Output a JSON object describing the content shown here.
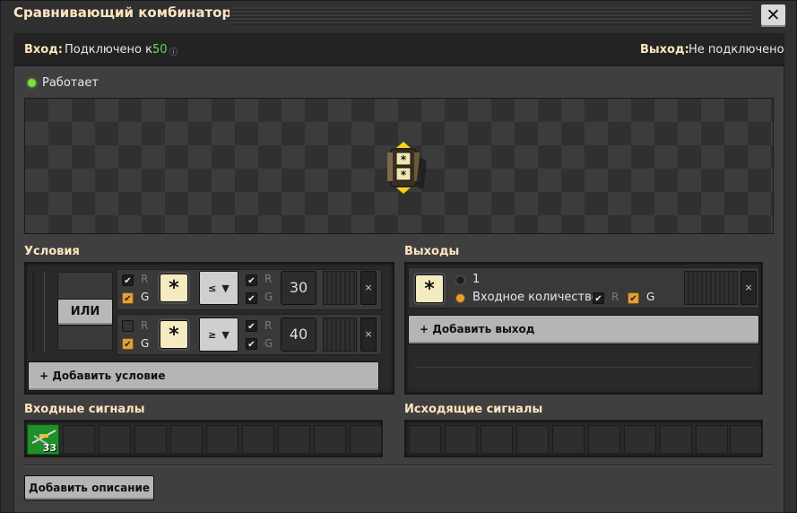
{
  "window": {
    "title": "Сравнивающий комбинатор",
    "close_label": "✕"
  },
  "status": {
    "input_label": "Вход:",
    "input_text": "Подключено к:",
    "input_count": "50",
    "output_label": "Выход:",
    "output_text": "Не подключено"
  },
  "state": {
    "text": "Работает"
  },
  "conditions": {
    "heading": "Условия",
    "or_label": "ИЛИ",
    "rows": [
      {
        "r": "R",
        "g": "G",
        "signal": "*",
        "operator": "≤",
        "r2": "R",
        "g2": "G",
        "value": "30",
        "remove": "×"
      },
      {
        "r": "R",
        "g": "G",
        "signal": "*",
        "operator": "≥",
        "r2": "R",
        "g2": "G",
        "value": "40",
        "remove": "×"
      }
    ],
    "add_label": "+ Добавить условие"
  },
  "outputs": {
    "heading": "Выходы",
    "row": {
      "signal": "*",
      "option1": "1",
      "option2": "Входное количество",
      "r": "R",
      "g": "G",
      "remove": "×"
    },
    "add_label": "+ Добавить выход"
  },
  "input_signals": {
    "heading": "Входные сигналы",
    "items": [
      {
        "icon": "rail-icon",
        "count": "33"
      }
    ]
  },
  "output_signals": {
    "heading": "Исходящие сигналы"
  },
  "footer": {
    "add_description": "Добавить описание"
  }
}
